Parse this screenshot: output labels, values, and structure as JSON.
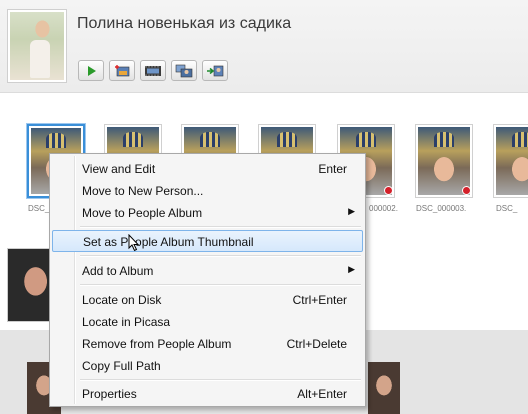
{
  "album": {
    "title": "Полина новенькая из садика"
  },
  "toolbar": {
    "buttons": [
      {
        "name": "play-slideshow-button",
        "icon": "play-icon"
      },
      {
        "name": "add-photo-button",
        "icon": "picture-add-icon"
      },
      {
        "name": "movie-button",
        "icon": "film-icon"
      },
      {
        "name": "collage-button",
        "icon": "collage-icon"
      },
      {
        "name": "export-button",
        "icon": "export-icon"
      }
    ]
  },
  "thumbnails": [
    {
      "label": "DSC_",
      "selected": true,
      "tagged": false
    },
    {
      "label": "",
      "selected": false,
      "tagged": false
    },
    {
      "label": "",
      "selected": false,
      "tagged": false
    },
    {
      "label": "",
      "selected": false,
      "tagged": false
    },
    {
      "label": "000002.",
      "selected": false,
      "tagged": true
    },
    {
      "label": "DSC_000003.",
      "selected": false,
      "tagged": true
    },
    {
      "label": "DSC_",
      "selected": false,
      "tagged": false
    }
  ],
  "context_menu": {
    "items": [
      {
        "label": "View and Edit",
        "shortcut": "Enter"
      },
      {
        "label": "Move to New Person...",
        "shortcut": ""
      },
      {
        "label": "Move to People Album",
        "shortcut": "",
        "submenu": true
      },
      {
        "separator": true
      },
      {
        "label": "Set as People Album Thumbnail",
        "shortcut": "",
        "highlighted": true
      },
      {
        "separator": true
      },
      {
        "label": "Add to Album",
        "shortcut": "",
        "submenu": true
      },
      {
        "separator": true
      },
      {
        "label": "Locate on Disk",
        "shortcut": "Ctrl+Enter"
      },
      {
        "label": "Locate in Picasa",
        "shortcut": ""
      },
      {
        "label": "Remove from People Album",
        "shortcut": "Ctrl+Delete"
      },
      {
        "label": "Copy Full Path",
        "shortcut": ""
      },
      {
        "separator": true
      },
      {
        "label": "Properties",
        "shortcut": "Alt+Enter"
      }
    ]
  },
  "colors": {
    "selection_border": "#3a8fd8",
    "menu_highlight": "#d6e8fb",
    "tag_pin": "#d4202a"
  }
}
